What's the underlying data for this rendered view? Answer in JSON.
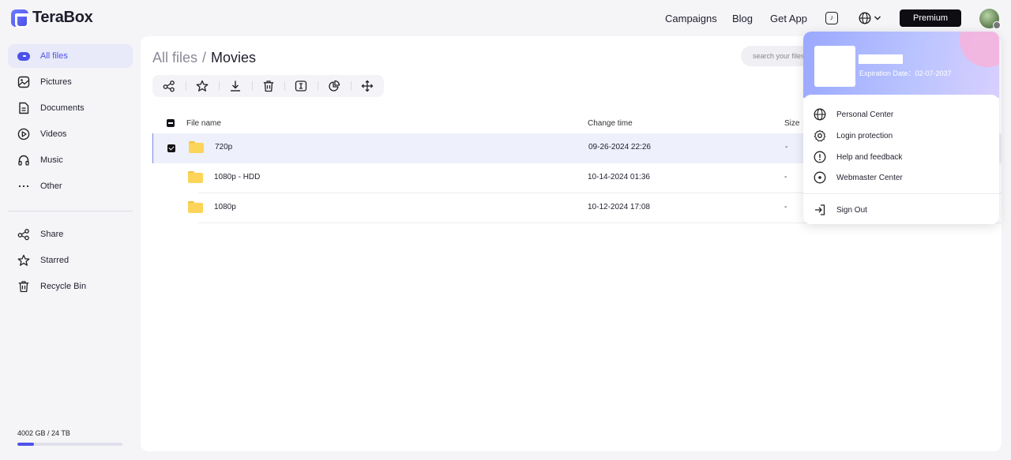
{
  "app": {
    "brand": "TeraBox"
  },
  "topnav": {
    "links": [
      "Campaigns",
      "Blog",
      "Get App"
    ],
    "premium_label": "Premium"
  },
  "sidebar": {
    "items": [
      {
        "label": "All files",
        "icon": "all-files-icon"
      },
      {
        "label": "Pictures",
        "icon": "picture-icon"
      },
      {
        "label": "Documents",
        "icon": "document-icon"
      },
      {
        "label": "Videos",
        "icon": "video-icon"
      },
      {
        "label": "Music",
        "icon": "headphones-icon"
      },
      {
        "label": "Other",
        "icon": "more-dots-icon"
      }
    ],
    "secondary": [
      {
        "label": "Share",
        "icon": "share-icon"
      },
      {
        "label": "Starred",
        "icon": "star-icon"
      },
      {
        "label": "Recycle Bin",
        "icon": "trash-icon"
      }
    ],
    "quota_text": "4002 GB / 24 TB",
    "quota_fraction": 0.16
  },
  "main": {
    "breadcrumb": {
      "root": "All files",
      "separator": "/",
      "current": "Movies"
    },
    "search_placeholder": "search your files",
    "toolbar_icons": [
      "share-icon",
      "star-icon",
      "download-icon",
      "trash-icon",
      "rename-icon",
      "pie-icon",
      "move-icon"
    ],
    "columns": {
      "name": "File name",
      "time": "Change time",
      "size": "Size"
    },
    "files": [
      {
        "name": "720p",
        "time": "09-26-2024 22:26",
        "size": "-",
        "selected": true
      },
      {
        "name": "1080p - HDD",
        "time": "10-14-2024 01:36",
        "size": "-",
        "selected": false
      },
      {
        "name": "1080p",
        "time": "10-12-2024 17:08",
        "size": "-",
        "selected": false
      }
    ]
  },
  "account_popup": {
    "expiry": "Expiration Date：02-07-2037",
    "menu": [
      {
        "label": "Personal Center",
        "icon": "globe-icon"
      },
      {
        "label": "Login protection",
        "icon": "gear-icon"
      },
      {
        "label": "Help and feedback",
        "icon": "info-icon"
      },
      {
        "label": "Webmaster Center",
        "icon": "target-icon"
      }
    ],
    "sign_out": "Sign Out"
  },
  "colors": {
    "accent": "#4d53e8",
    "selected_row": "#eef0fb",
    "folder": "#fdd45a"
  }
}
